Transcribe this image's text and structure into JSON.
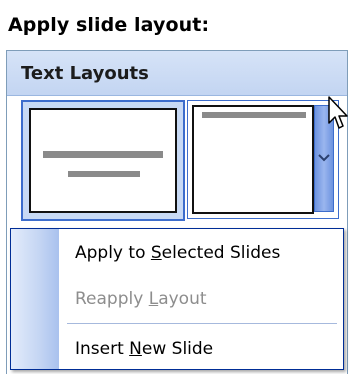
{
  "section": {
    "heading": "Apply slide layout:"
  },
  "panel": {
    "title": "Text Layouts",
    "layouts": [
      {
        "icon": "title-slide-layout-thumbnail",
        "state": "selected"
      },
      {
        "icon": "title-only-layout-thumbnail",
        "state": "hover"
      }
    ]
  },
  "context_menu": {
    "items": [
      {
        "pre": "Apply to ",
        "key": "S",
        "post": "elected Slides",
        "enabled": true
      },
      {
        "pre": "Reapply ",
        "key": "L",
        "post": "ayout",
        "enabled": false
      },
      {
        "pre": "Insert ",
        "key": "N",
        "post": "ew Slide",
        "enabled": true
      }
    ]
  },
  "icons": {
    "dropdown": "chevron-down-icon",
    "cursor": "mouse-pointer-icon"
  },
  "colors": {
    "accent": "#3d6dcc",
    "menu_border": "#002d96",
    "disabled_text": "#8d8d8d",
    "panel_header": "#c3d5f2"
  }
}
